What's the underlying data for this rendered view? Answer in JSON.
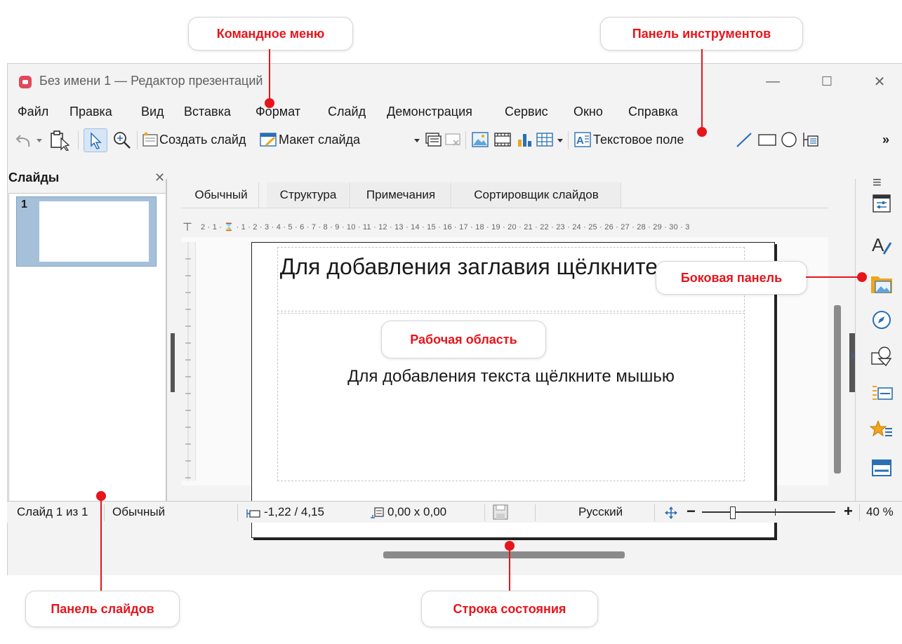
{
  "callouts": {
    "command_menu": "Командное меню",
    "toolbar": "Панель инструментов",
    "sidebar": "Боковая панель",
    "workspace": "Рабочая область",
    "slides_panel": "Панель слайдов",
    "status_bar": "Строка состояния"
  },
  "window": {
    "title": "Без имени 1 — Редактор презентаций",
    "minimize_glyph": "—",
    "maximize_glyph": "☐",
    "close_glyph": "✕"
  },
  "menu": [
    "Файл",
    "Правка",
    "Вид",
    "Вставка",
    "Формат",
    "Слайд",
    "Демонстрация",
    "Сервис",
    "Окно",
    "Справка"
  ],
  "toolbar": {
    "new_slide": "Создать слайд",
    "slide_layout": "Макет слайда",
    "text_box": "Текстовое поле",
    "more": "»"
  },
  "slides_panel": {
    "title": "Слайды",
    "close": "✕",
    "slide_number": "1"
  },
  "tabs": [
    "Обычный",
    "Структура",
    "Примечания",
    "Сортировщик слайдов"
  ],
  "ruler": {
    "horizontal": "2 · 1 · ⌛ · 1 · 2 · 3 · 4 · 5 · 6 · 7 · 8 · 9 · 10 · 11 · 12 · 13 · 14 · 15 · 16 · 17 · 18 · 19 · 20 · 21 · 22 · 23 · 24 · 25 · 26 · 27 · 28 · 29 · 30 · 3"
  },
  "slide": {
    "title_placeholder": "Для добавления заглавия щёлкните мышью",
    "text_placeholder": "Для добавления текста щёлкните мышью"
  },
  "statusbar": {
    "slide_info": "Слайд 1 из 1",
    "layout": "Обычный",
    "position": "-1,22 / 4,15",
    "size": "0,00 x 0,00",
    "language": "Русский",
    "zoom_minus": "−",
    "zoom_plus": "+",
    "zoom": "40 %"
  },
  "colors": {
    "accent": "#e8141b",
    "window_bg": "#f3f3f3",
    "thumb_selected": "#a6c0d9"
  }
}
